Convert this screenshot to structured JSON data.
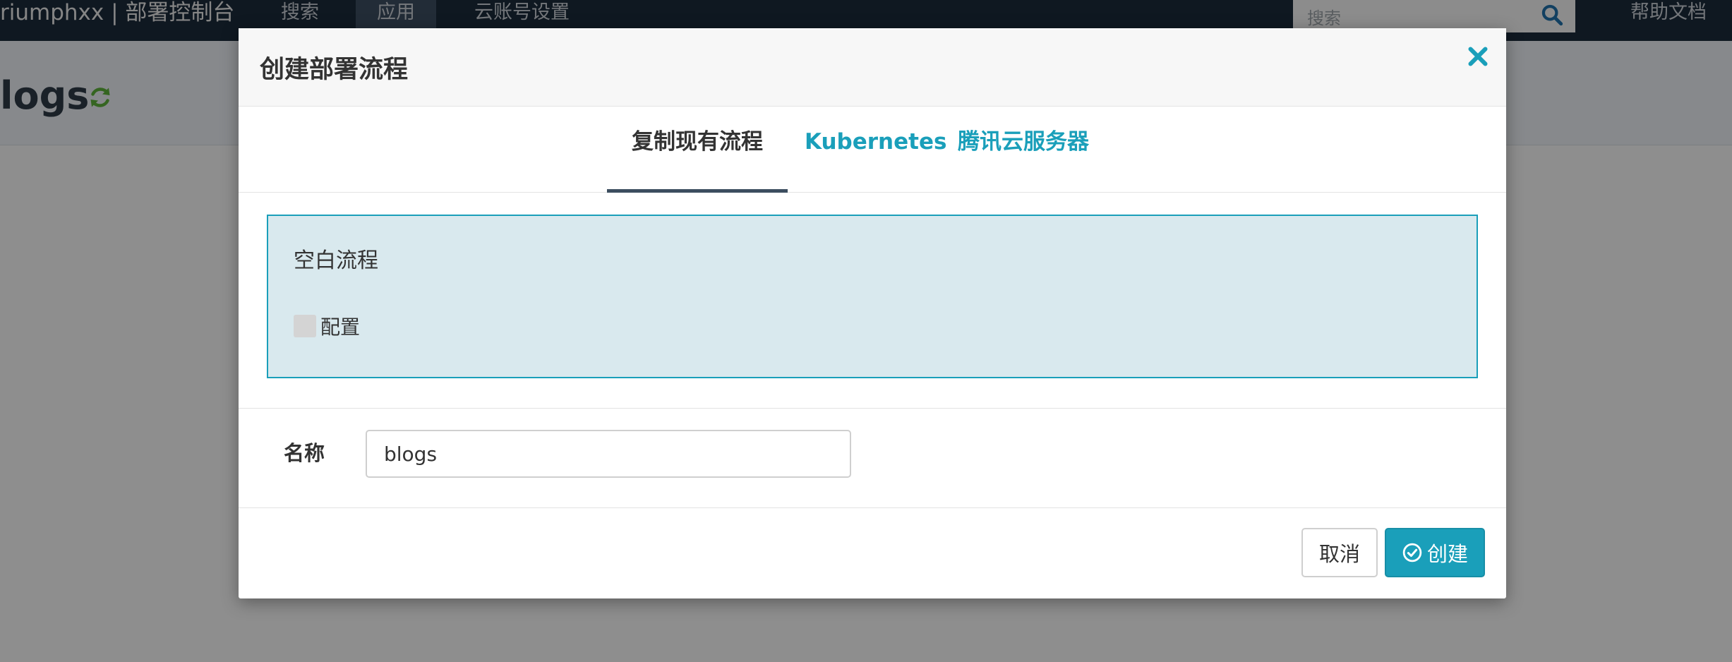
{
  "topbar": {
    "brand": "riumphxx | 部署控制台",
    "nav": [
      {
        "label": "搜索"
      },
      {
        "label": "应用"
      },
      {
        "label": "云账号设置"
      }
    ],
    "search_placeholder": "搜索",
    "help": "帮助文档"
  },
  "page": {
    "title": "logs"
  },
  "modal": {
    "title": "创建部署流程",
    "tabs": [
      {
        "label": "复制现有流程",
        "active": true
      },
      {
        "label": "Kubernetes",
        "active": false
      },
      {
        "label": "腾讯云服务器",
        "active": false
      }
    ],
    "flow_card": {
      "name": "空白流程",
      "stage_label": "配置"
    },
    "form": {
      "name_label": "名称",
      "name_value": "blogs"
    },
    "buttons": {
      "cancel": "取消",
      "create": "创建"
    }
  },
  "colors": {
    "accent": "#1a9fba",
    "navbar": "#1b2a3a",
    "card_bg": "#d9e9ee"
  },
  "icons": {
    "search": "search-icon",
    "refresh": "refresh-icon",
    "close": "close-icon",
    "create": "check-circle-icon"
  }
}
